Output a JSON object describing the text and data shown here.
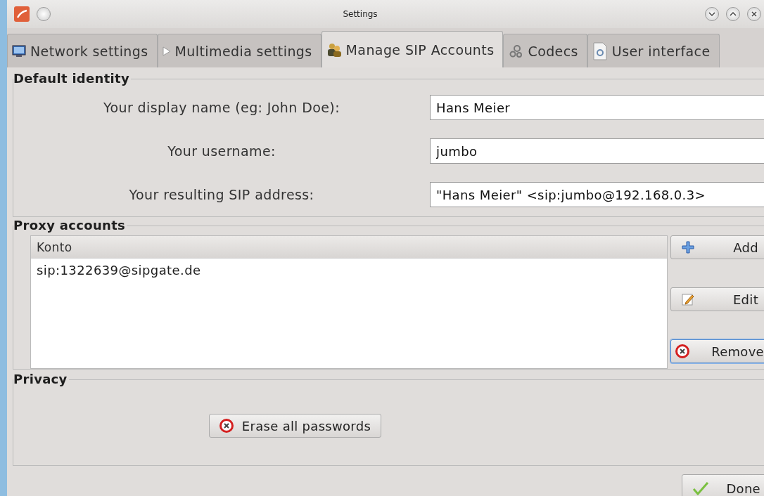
{
  "window": {
    "title": "Settings"
  },
  "tabs": [
    {
      "label": "Network settings",
      "selected": false
    },
    {
      "label": "Multimedia settings",
      "selected": false
    },
    {
      "label": "Manage SIP Accounts",
      "selected": true
    },
    {
      "label": "Codecs",
      "selected": false
    },
    {
      "label": "User interface",
      "selected": false
    }
  ],
  "default_identity": {
    "title": "Default identity",
    "fields": [
      {
        "label": "Your display name (eg: John Doe):",
        "value": "Hans Meier"
      },
      {
        "label": "Your username:",
        "value": "jumbo"
      },
      {
        "label": "Your resulting SIP address:",
        "value": "\"Hans Meier\" <sip:jumbo@192.168.0.3>"
      }
    ]
  },
  "proxy_accounts": {
    "title": "Proxy accounts",
    "column": "Konto",
    "rows": [
      "sip:1322639@sipgate.de"
    ],
    "buttons": [
      {
        "label": "Add",
        "focused": false
      },
      {
        "label": "Edit",
        "focused": false
      },
      {
        "label": "Remove",
        "focused": true
      }
    ]
  },
  "privacy": {
    "title": "Privacy",
    "button": "Erase all passwords"
  },
  "footer": {
    "button": "Done"
  }
}
